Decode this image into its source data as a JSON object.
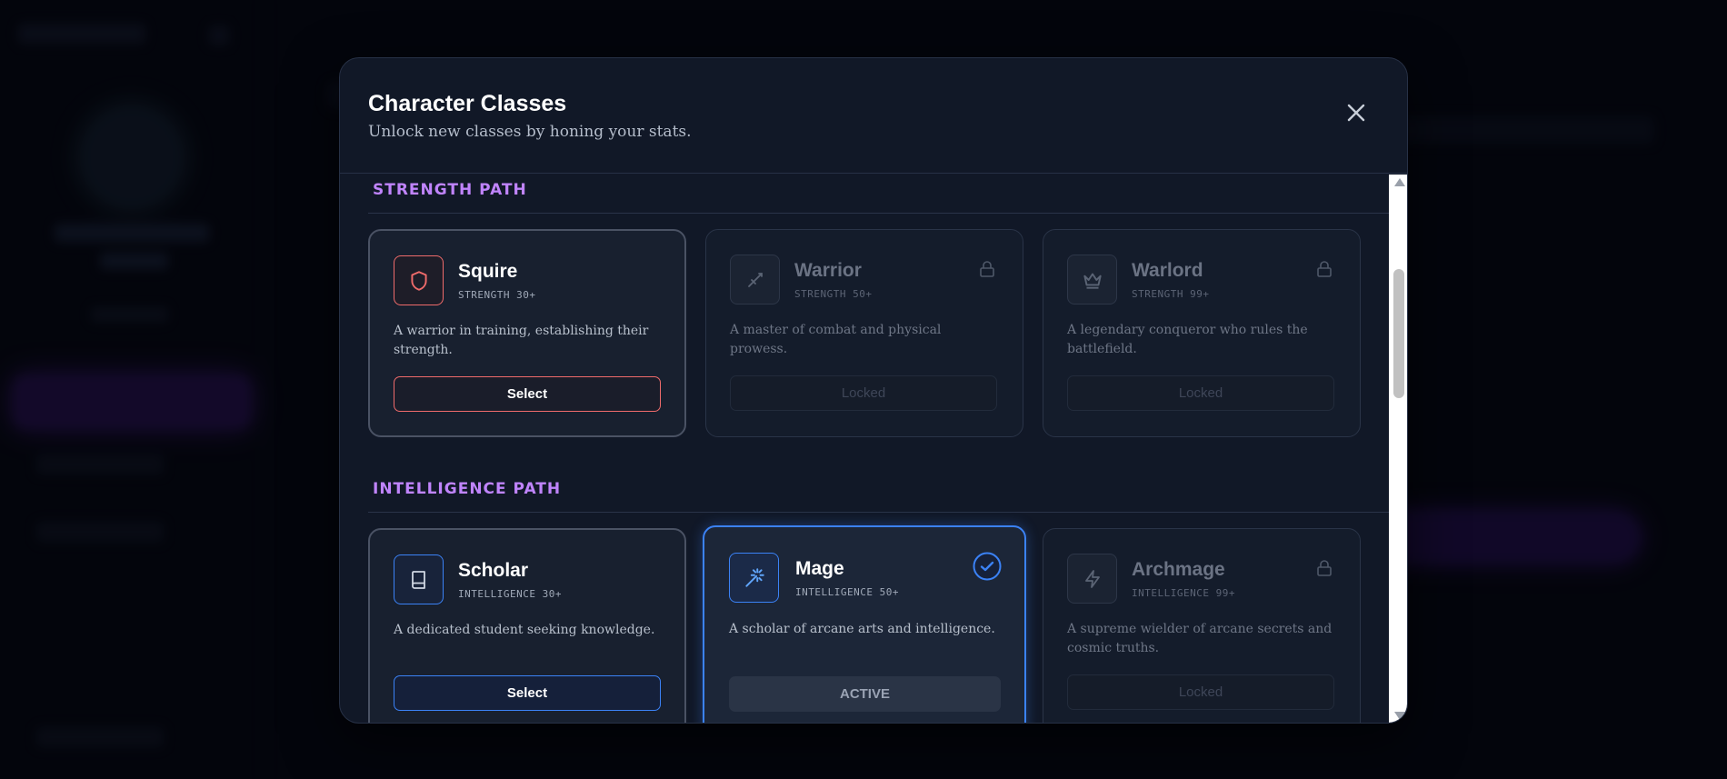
{
  "modal": {
    "title": "Character Classes",
    "subtitle": "Unlock new classes by honing your stats."
  },
  "sections": [
    {
      "title": "STRENGTH PATH",
      "cards": [
        {
          "name": "Squire",
          "requirement": "STRENGTH 30+",
          "description": "A warrior in training, establishing their strength.",
          "button": "Select",
          "state": "unlocked",
          "icon": "shield-icon"
        },
        {
          "name": "Warrior",
          "requirement": "STRENGTH 50+",
          "description": "A master of combat and physical prowess.",
          "button": "Locked",
          "state": "locked",
          "icon": "sword-icon"
        },
        {
          "name": "Warlord",
          "requirement": "STRENGTH 99+",
          "description": "A legendary conqueror who rules the battlefield.",
          "button": "Locked",
          "state": "locked",
          "icon": "crown-icon"
        }
      ]
    },
    {
      "title": "INTELLIGENCE PATH",
      "cards": [
        {
          "name": "Scholar",
          "requirement": "INTELLIGENCE 30+",
          "description": "A dedicated student seeking knowledge.",
          "button": "Select",
          "state": "unlocked",
          "icon": "book-icon"
        },
        {
          "name": "Mage",
          "requirement": "INTELLIGENCE 50+",
          "description": "A scholar of arcane arts and intelligence.",
          "button": "ACTIVE",
          "state": "active",
          "icon": "magic-wand-icon"
        },
        {
          "name": "Archmage",
          "requirement": "INTELLIGENCE 99+",
          "description": "A supreme wielder of arcane secrets and cosmic truths.",
          "button": "Locked",
          "state": "locked",
          "icon": "lightning-icon"
        }
      ]
    }
  ],
  "colors": {
    "section_title": "#c084fc",
    "strength_accent": "#ef6b6b",
    "intelligence_accent": "#3b82f6",
    "active_border": "#3b82f6"
  }
}
